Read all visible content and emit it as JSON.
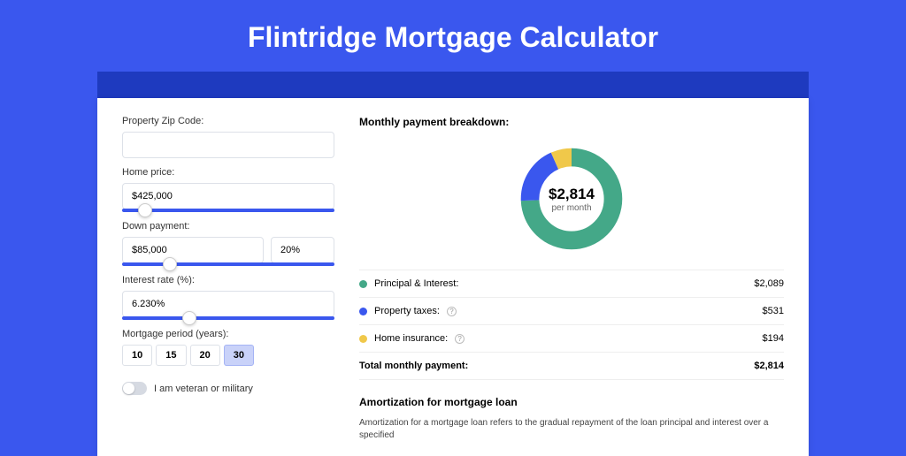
{
  "title": "Flintridge Mortgage Calculator",
  "form": {
    "zip_label": "Property Zip Code:",
    "zip_value": "",
    "price_label": "Home price:",
    "price_value": "$425,000",
    "down_label": "Down payment:",
    "down_value": "$85,000",
    "down_pct": "20%",
    "rate_label": "Interest rate (%):",
    "rate_value": "6.230%",
    "period_label": "Mortgage period (years):",
    "periods": [
      "10",
      "15",
      "20",
      "30"
    ],
    "period_active": "30",
    "veteran_label": "I am veteran or military"
  },
  "breakdown": {
    "title": "Monthly payment breakdown:",
    "total_value": "$2,814",
    "total_sub": "per month",
    "rows": [
      {
        "label": "Principal & Interest:",
        "value": "$2,089",
        "color": "g",
        "help": false
      },
      {
        "label": "Property taxes:",
        "value": "$531",
        "color": "b",
        "help": true
      },
      {
        "label": "Home insurance:",
        "value": "$194",
        "color": "y",
        "help": true
      }
    ],
    "total_label": "Total monthly payment:",
    "total_row_value": "$2,814"
  },
  "chart_data": {
    "type": "pie",
    "title": "Monthly payment breakdown",
    "series": [
      {
        "name": "Principal & Interest",
        "value": 2089,
        "color": "#44a888"
      },
      {
        "name": "Property taxes",
        "value": 531,
        "color": "#3a57ee"
      },
      {
        "name": "Home insurance",
        "value": 194,
        "color": "#f0c84a"
      }
    ],
    "total": 2814
  },
  "amort": {
    "title": "Amortization for mortgage loan",
    "text": "Amortization for a mortgage loan refers to the gradual repayment of the loan principal and interest over a specified"
  }
}
